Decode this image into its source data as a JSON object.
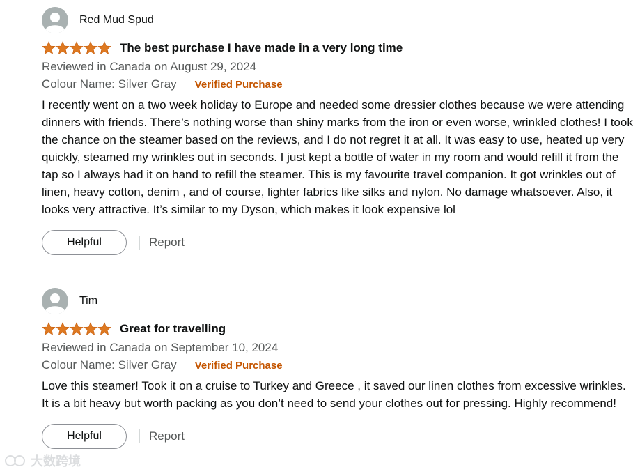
{
  "reviews": [
    {
      "profile_name": "Red Mud Spud",
      "rating": 5,
      "title": "The best purchase I have made in a very long time",
      "date_line": "Reviewed in Canada on August 29, 2024",
      "variant": "Colour Name: Silver Gray",
      "verified": "Verified Purchase",
      "body": "I recently went on a two week holiday to Europe and needed some dressier clothes because we were attending dinners with friends. There’s nothing worse than shiny marks from the iron or even worse, wrinkled clothes! I took the chance on the steamer based on the reviews, and I do not regret it at all. It was easy to use, heated up very quickly, steamed my wrinkles out in seconds. I just kept a bottle of water in my room and would refill it from the tap so I always had it on hand to refill the steamer. This is my favourite travel companion. It got wrinkles out of linen, heavy cotton, denim , and of course, lighter fabrics like silks and nylon. No damage whatsoever. Also, it looks very attractive. It’s similar to my Dyson, which makes it look expensive lol",
      "helpful_label": "Helpful",
      "report_label": "Report"
    },
    {
      "profile_name": "Tim",
      "rating": 5,
      "title": "Great for travelling",
      "date_line": "Reviewed in Canada on September 10, 2024",
      "variant": "Colour Name: Silver Gray",
      "verified": "Verified Purchase",
      "body": "Love this steamer! Took it on a cruise to Turkey and Greece , it saved our linen clothes from excessive wrinkles. It is a bit heavy but worth packing as you don’t need to send your clothes out for pressing. Highly recommend!",
      "helpful_label": "Helpful",
      "report_label": "Report"
    }
  ],
  "watermark": "大数跨境",
  "colors": {
    "star": "#de7921",
    "verified": "#c45500",
    "secondary_text": "#565959",
    "avatar_bg": "#a9b1b1"
  },
  "icons": [
    "avatar-icon",
    "star-icon"
  ]
}
